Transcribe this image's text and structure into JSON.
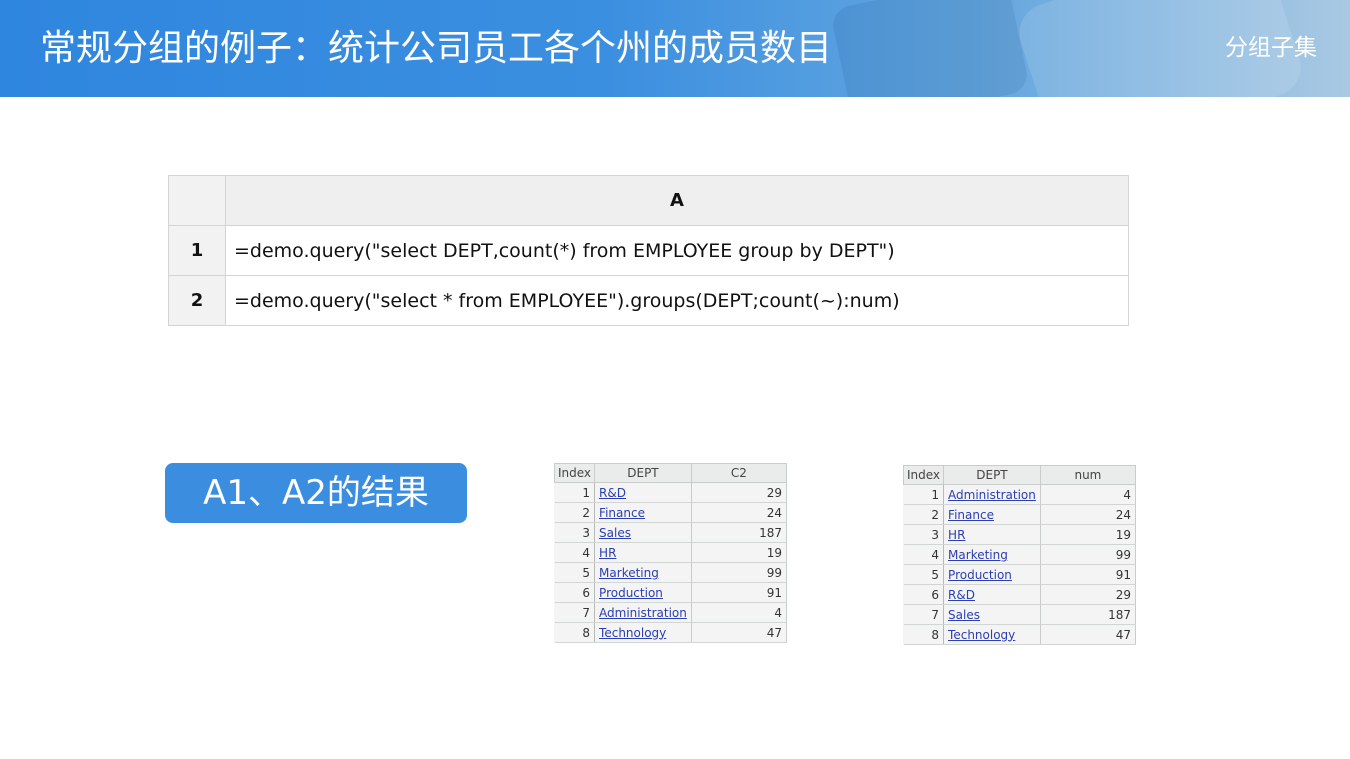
{
  "header": {
    "title": "常规分组的例子：统计公司员工各个州的成员数目",
    "section": "分组子集"
  },
  "code_grid": {
    "column_header": "A",
    "rows": [
      {
        "index": "1",
        "code": "=demo.query(\"select DEPT,count(*)  from EMPLOYEE group by DEPT\")"
      },
      {
        "index": "2",
        "code": "=demo.query(\"select * from EMPLOYEE\").groups(DEPT;count(~):num)"
      }
    ]
  },
  "result_label": "A1、A2的结果",
  "result_a1": {
    "headers": [
      "Index",
      "DEPT",
      "C2"
    ],
    "rows": [
      [
        "1",
        "R&D",
        "29"
      ],
      [
        "2",
        "Finance",
        "24"
      ],
      [
        "3",
        "Sales",
        "187"
      ],
      [
        "4",
        "HR",
        "19"
      ],
      [
        "5",
        "Marketing",
        "99"
      ],
      [
        "6",
        "Production",
        "91"
      ],
      [
        "7",
        "Administration",
        "4"
      ],
      [
        "8",
        "Technology",
        "47"
      ]
    ]
  },
  "result_a2": {
    "headers": [
      "Index",
      "DEPT",
      "num"
    ],
    "rows": [
      [
        "1",
        "Administration",
        "4"
      ],
      [
        "2",
        "Finance",
        "24"
      ],
      [
        "3",
        "HR",
        "19"
      ],
      [
        "4",
        "Marketing",
        "99"
      ],
      [
        "5",
        "Production",
        "91"
      ],
      [
        "6",
        "R&D",
        "29"
      ],
      [
        "7",
        "Sales",
        "187"
      ],
      [
        "8",
        "Technology",
        "47"
      ]
    ]
  }
}
